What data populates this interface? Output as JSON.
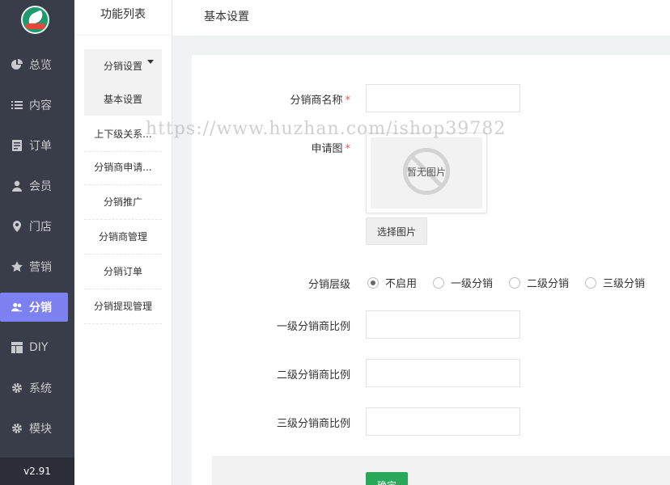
{
  "nav": {
    "items": [
      {
        "label": "总览",
        "icon": "pie-chart-icon"
      },
      {
        "label": "内容",
        "icon": "list-icon"
      },
      {
        "label": "订单",
        "icon": "order-icon"
      },
      {
        "label": "会员",
        "icon": "user-icon"
      },
      {
        "label": "门店",
        "icon": "location-icon"
      },
      {
        "label": "营销",
        "icon": "star-icon"
      },
      {
        "label": "分销",
        "icon": "users-icon"
      },
      {
        "label": "DIY",
        "icon": "layout-icon"
      },
      {
        "label": "系统",
        "icon": "gear-icon"
      },
      {
        "label": "模块",
        "icon": "gear-icon"
      }
    ],
    "active": "分销",
    "version": "v2.91"
  },
  "sub": {
    "title": "功能列表",
    "group_title": "分销设置",
    "group_item": "基本设置",
    "items": [
      "上下级关系...",
      "分销商申请...",
      "分销推广",
      "分销商管理",
      "分销订单",
      "分销提现管理"
    ]
  },
  "topbar": {
    "crumb": "基本设置"
  },
  "form": {
    "name_label": "分销商名称",
    "image_label": "申请图",
    "no_image_text": "暂无图片",
    "choose_image": "选择图片",
    "level_label": "分销层级",
    "level_options": [
      "不启用",
      "一级分销",
      "二级分销",
      "三级分销"
    ],
    "level_selected": "不启用",
    "ratio1_label": "一级分销商比例",
    "ratio2_label": "二级分销商比例",
    "ratio3_label": "三级分销商比例",
    "submit": "确定",
    "required_mark": "*"
  },
  "watermark": "https://www.huzhan.com/ishop39782",
  "colors": {
    "nav_bg": "#393d49",
    "active": "#7d80f1",
    "submit": "#2aa85a",
    "required": "#ff4d4f"
  }
}
